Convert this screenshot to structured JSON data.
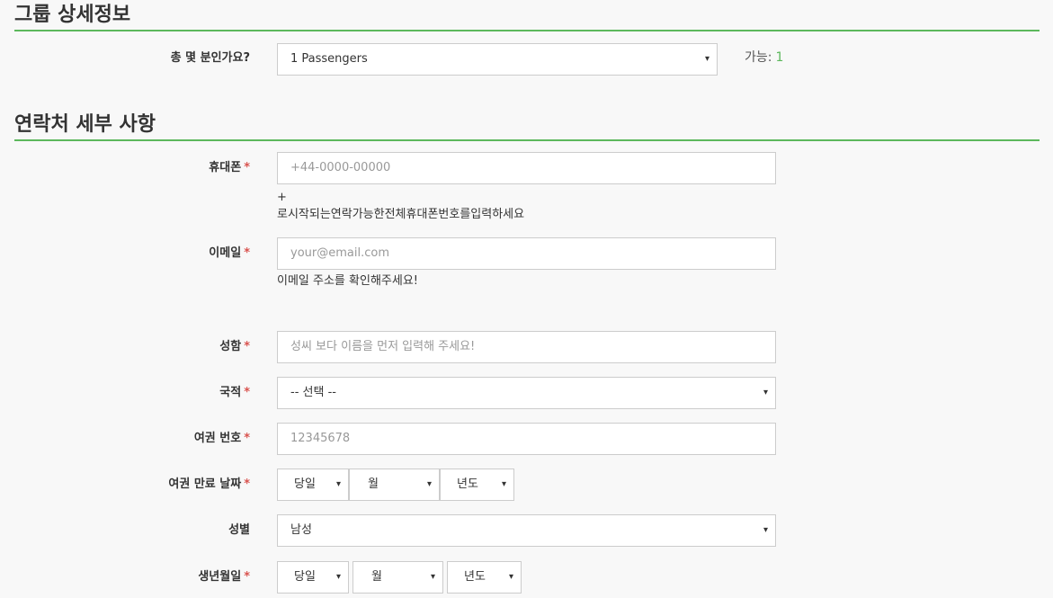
{
  "group_section": {
    "title": "그룹 상세정보",
    "passenger_label": "총 몇 분인가요?",
    "passenger_select_value": "1 Passengers",
    "available_label": "가능:",
    "available_count": "1"
  },
  "contact_section": {
    "title": "연락처 세부 사항",
    "required_marker": "*",
    "phone": {
      "label": "휴대폰",
      "placeholder": "+44-0000-00000",
      "help_line1": "+",
      "help_line2": "로시작되는연락가능한전체휴대폰번호를입력하세요"
    },
    "email": {
      "label": "이메일",
      "placeholder": "your@email.com",
      "help": "이메일 주소를 확인해주세요!"
    },
    "name": {
      "label": "성함",
      "placeholder": "성씨 보다 이름을 먼저 입력해 주세요!"
    },
    "nationality": {
      "label": "국적",
      "value": "-- 선택 --"
    },
    "passport_number": {
      "label": "여권 번호",
      "placeholder": "12345678"
    },
    "passport_expiry": {
      "label": "여권 만료 날짜",
      "day": "당일",
      "month": "월",
      "year": "년도"
    },
    "gender": {
      "label": "성별",
      "value": "남성"
    },
    "birthdate": {
      "label": "생년월일",
      "day": "당일",
      "month": "월",
      "year": "년도"
    }
  },
  "icons": {
    "select_caret": "▾"
  },
  "colors": {
    "accent_green": "#5cb85c",
    "required_red": "#d9534f"
  }
}
